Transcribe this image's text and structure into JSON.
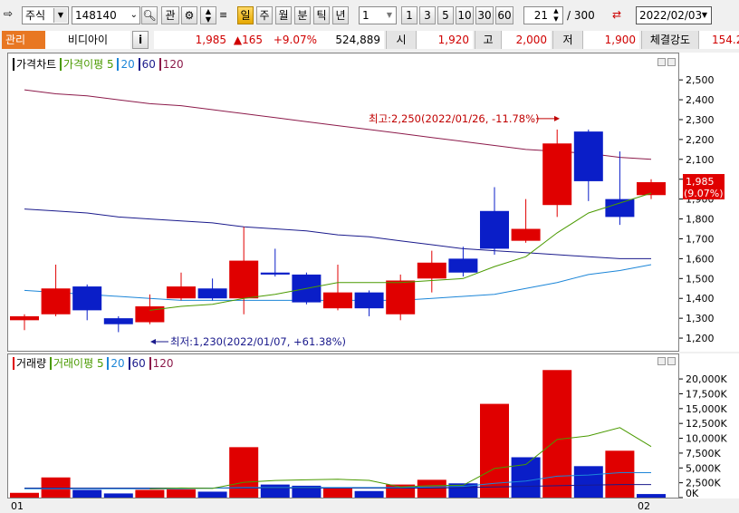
{
  "toolbar": {
    "market": "주식",
    "code": "148140",
    "btn_gwan": "관",
    "periods": [
      "일",
      "주",
      "월",
      "분",
      "틱",
      "년"
    ],
    "interval_value": "1",
    "quick_intervals": [
      "1",
      "3",
      "5",
      "10",
      "30",
      "60"
    ],
    "count_value": "21",
    "total_value": "/ 300",
    "date_value": "2022/02/03"
  },
  "quote": {
    "tag": "관리",
    "name": "비디아이",
    "info_btn": "i",
    "price": "1,985",
    "change": "▲165",
    "change_pct": "+9.07%",
    "volume": "524,889",
    "open_label": "시",
    "open": "1,920",
    "high_label": "고",
    "high": "2,000",
    "low_label": "저",
    "low": "1,900",
    "strength_label": "체결강도",
    "strength": "154.2"
  },
  "colors": {
    "up": "#e00000",
    "down": "#0a1ec8",
    "ma5": "#4a9a00",
    "ma20": "#1c86d8",
    "ma60": "#1a1a8c",
    "ma120": "#8c1a4a"
  },
  "price_legend": {
    "main": "가격차트",
    "ma_label": "가격이평",
    "p5": "5",
    "p20": "20",
    "p60": "60",
    "p120": "120"
  },
  "volume_legend": {
    "main": "거래량",
    "ma_label": "거래이평",
    "p5": "5",
    "p20": "20",
    "p60": "60",
    "p120": "120"
  },
  "annotations": {
    "high": "최고:2,250(2022/01/26, -11.78%)",
    "low": "최저:1,230(2022/01/07, +61.38%)",
    "current_price": "1,985",
    "current_pct": "(9.07%)"
  },
  "x_labels": [
    "01",
    "02"
  ],
  "chart_data": [
    {
      "type": "candlestick",
      "title": "가격차트",
      "ylim": [
        1150,
        2560
      ],
      "yticks": [
        1200,
        1300,
        1400,
        1500,
        1600,
        1700,
        1800,
        1900,
        2000,
        2100,
        2200,
        2300,
        2400,
        2500
      ],
      "ytick_labels": [
        "1,200",
        "1,300",
        "1,400",
        "1,500",
        "1,600",
        "1,700",
        "1,800",
        "1,900",
        "2,000",
        "2,100",
        "2,200",
        "2,300",
        "2,400",
        "2,500"
      ],
      "candles": [
        {
          "o": 1290,
          "c": 1310,
          "h": 1320,
          "l": 1240
        },
        {
          "o": 1320,
          "c": 1450,
          "h": 1570,
          "l": 1310
        },
        {
          "o": 1460,
          "c": 1340,
          "h": 1470,
          "l": 1290
        },
        {
          "o": 1300,
          "c": 1270,
          "h": 1310,
          "l": 1230
        },
        {
          "o": 1280,
          "c": 1360,
          "h": 1420,
          "l": 1270
        },
        {
          "o": 1400,
          "c": 1460,
          "h": 1530,
          "l": 1390
        },
        {
          "o": 1450,
          "c": 1400,
          "h": 1500,
          "l": 1390
        },
        {
          "o": 1400,
          "c": 1590,
          "h": 1760,
          "l": 1320
        },
        {
          "o": 1530,
          "c": 1520,
          "h": 1650,
          "l": 1510
        },
        {
          "o": 1520,
          "c": 1380,
          "h": 1530,
          "l": 1370
        },
        {
          "o": 1350,
          "c": 1430,
          "h": 1570,
          "l": 1340
        },
        {
          "o": 1430,
          "c": 1350,
          "h": 1440,
          "l": 1310
        },
        {
          "o": 1320,
          "c": 1490,
          "h": 1520,
          "l": 1290
        },
        {
          "o": 1500,
          "c": 1580,
          "h": 1640,
          "l": 1430
        },
        {
          "o": 1600,
          "c": 1530,
          "h": 1660,
          "l": 1510
        },
        {
          "o": 1840,
          "c": 1650,
          "h": 1960,
          "l": 1620
        },
        {
          "o": 1690,
          "c": 1750,
          "h": 1900,
          "l": 1680
        },
        {
          "o": 1870,
          "c": 2180,
          "h": 2250,
          "l": 1810
        },
        {
          "o": 2240,
          "c": 1990,
          "h": 2250,
          "l": 1890
        },
        {
          "o": 1900,
          "c": 1810,
          "h": 2140,
          "l": 1770
        },
        {
          "o": 1920,
          "c": 1985,
          "h": 2000,
          "l": 1900
        }
      ],
      "ma5": [
        null,
        null,
        null,
        null,
        1340,
        1360,
        1370,
        1400,
        1420,
        1450,
        1480,
        1480,
        1480,
        1490,
        1500,
        1560,
        1610,
        1730,
        1830,
        1880,
        1930
      ],
      "ma20": [
        1440,
        1430,
        1420,
        1410,
        1400,
        1390,
        1390,
        1390,
        1390,
        1390,
        1390,
        1390,
        1390,
        1400,
        1410,
        1420,
        1450,
        1480,
        1520,
        1540,
        1570
      ],
      "ma60": [
        1850,
        1840,
        1830,
        1810,
        1800,
        1790,
        1780,
        1760,
        1750,
        1740,
        1720,
        1710,
        1690,
        1670,
        1650,
        1640,
        1630,
        1620,
        1610,
        1600,
        1600
      ],
      "ma120": [
        2450,
        2430,
        2420,
        2400,
        2380,
        2370,
        2350,
        2330,
        2310,
        2290,
        2270,
        2250,
        2230,
        2210,
        2190,
        2170,
        2150,
        2140,
        2130,
        2110,
        2100
      ]
    },
    {
      "type": "bar",
      "title": "거래량",
      "ylim": [
        0,
        22000
      ],
      "yticks": [
        0,
        2500,
        5000,
        7500,
        10000,
        12500,
        15000,
        17500,
        20000
      ],
      "ytick_labels": [
        "0K",
        "2,500K",
        "5,000K",
        "7,500K",
        "10,000K",
        "12,500K",
        "15,000K",
        "17,500K",
        "20,000K"
      ],
      "values": [
        800,
        3400,
        1300,
        700,
        1300,
        1400,
        1000,
        8500,
        2200,
        2000,
        1700,
        1100,
        2200,
        3000,
        2400,
        15800,
        6800,
        21500,
        5300,
        7900,
        600
      ],
      "directions": [
        "up",
        "up",
        "down",
        "down",
        "up",
        "up",
        "down",
        "up",
        "down",
        "down",
        "up",
        "down",
        "up",
        "up",
        "down",
        "up",
        "down",
        "up",
        "down",
        "up",
        "down"
      ],
      "ma5": [
        null,
        null,
        null,
        null,
        1500,
        1620,
        1540,
        2580,
        2880,
        3000,
        3080,
        2900,
        1800,
        2020,
        2080,
        4900,
        5580,
        9800,
        10400,
        11800,
        8600
      ],
      "ma20": [
        1500,
        1500,
        1500,
        1500,
        1500,
        1500,
        1600,
        1700,
        1700,
        1700,
        1700,
        1700,
        1700,
        1800,
        1900,
        2400,
        2800,
        3600,
        3800,
        4200,
        4200
      ],
      "ma60": [
        1600,
        1600,
        1600,
        1600,
        1600,
        1600,
        1600,
        1600,
        1600,
        1600,
        1600,
        1600,
        1600,
        1600,
        1700,
        1800,
        1900,
        2000,
        2100,
        2200,
        2200
      ]
    }
  ]
}
